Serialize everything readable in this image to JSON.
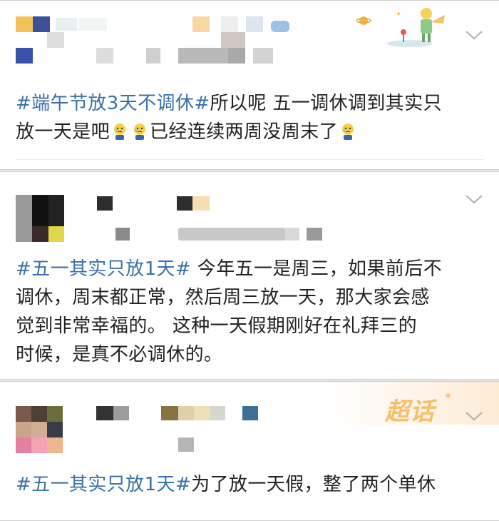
{
  "posts": [
    {
      "hashtag": "#端午节放3天不调休#",
      "body_line1": "所以呢 五一调休调到其实只",
      "body_line2": "放一天是吧",
      "body_line2b": "已经连续两周没周末了"
    },
    {
      "hashtag": "#五一其实只放1天#",
      "body_line1": " 今年五一是周三，如果前后不",
      "body_line2": "调休，周末都正常，然后周三放一天，那大家会感",
      "body_line3": "觉到非常幸福的。 这种一天假期刚好在礼拜三的",
      "body_line4": "时候，是真不必调休的。"
    },
    {
      "hashtag": "#五一其实只放1天#",
      "body_line1": "为了放一天假，整了两个单休",
      "badge": "超话"
    }
  ],
  "colors": {
    "hashtag": "#3b6fa8",
    "text": "#222222",
    "background": "#e9e9e9",
    "badge": "#f6bf6a"
  },
  "icons": [
    "chevron-down-icon",
    "crying-emoji-icon",
    "little-prince-decoration-icon"
  ]
}
